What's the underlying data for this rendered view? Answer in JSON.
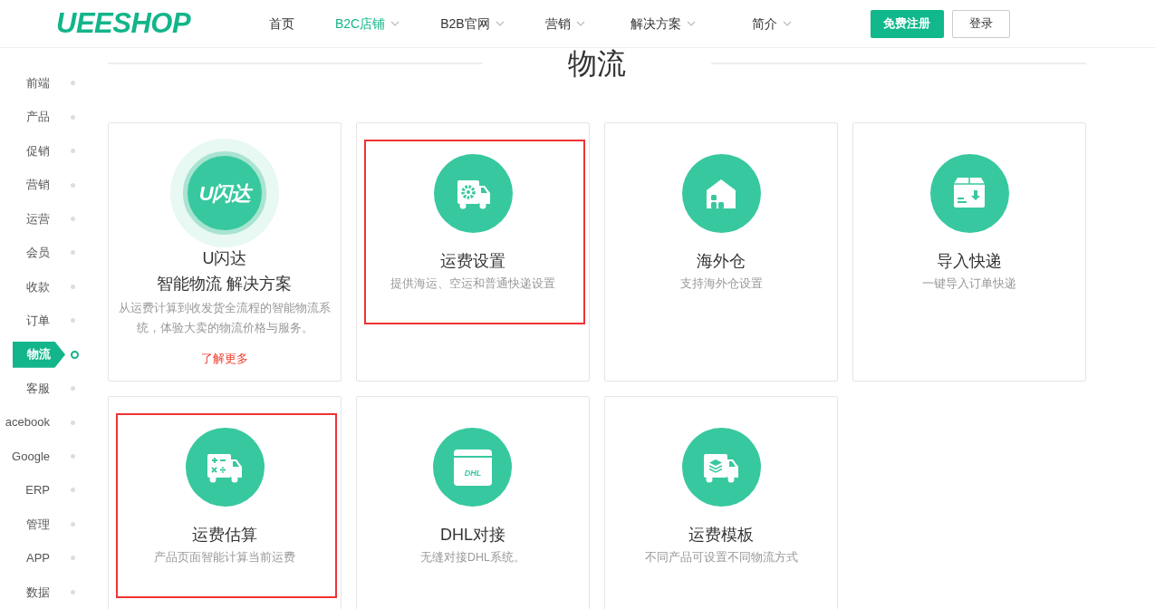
{
  "header": {
    "logo": "UEESHOP",
    "nav": [
      {
        "label": "首页",
        "selected": false,
        "dropdown": false
      },
      {
        "label": "B2C店铺",
        "selected": true,
        "dropdown": true
      },
      {
        "label": "B2B官网",
        "selected": false,
        "dropdown": true
      },
      {
        "label": "营销",
        "selected": false,
        "dropdown": true
      },
      {
        "label": "解决方案",
        "selected": false,
        "dropdown": true
      },
      {
        "label": "简介",
        "selected": false,
        "dropdown": true
      }
    ],
    "register_button": "免费注册",
    "login_button": "登录"
  },
  "sidebar": {
    "items": [
      {
        "label": "前端",
        "selected": false
      },
      {
        "label": "产品",
        "selected": false
      },
      {
        "label": "促销",
        "selected": false
      },
      {
        "label": "营销",
        "selected": false
      },
      {
        "label": "运营",
        "selected": false
      },
      {
        "label": "会员",
        "selected": false
      },
      {
        "label": "收款",
        "selected": false
      },
      {
        "label": "订单",
        "selected": false
      },
      {
        "label": "物流",
        "selected": true
      },
      {
        "label": "客服",
        "selected": false
      },
      {
        "label": "acebook",
        "selected": false
      },
      {
        "label": "Google",
        "selected": false
      },
      {
        "label": "ERP",
        "selected": false
      },
      {
        "label": "管理",
        "selected": false
      },
      {
        "label": "APP",
        "selected": false
      },
      {
        "label": "数据",
        "selected": false
      }
    ]
  },
  "section_title": "物流",
  "cards": [
    {
      "kind": "featured",
      "logo_text": "U闪达",
      "title": "U闪达",
      "subtitle": "智能物流 解决方案",
      "description": "从运费计算到收发货全流程的智能物流系统，体验大卖的物流价格与服务。",
      "link": "了解更多",
      "highlighted": false
    },
    {
      "kind": "feature",
      "title": "运费设置",
      "description": "提供海运、空运和普通快递设置",
      "highlighted": true
    },
    {
      "kind": "feature",
      "title": "海外仓",
      "description": "支持海外仓设置",
      "highlighted": false
    },
    {
      "kind": "feature",
      "title": "导入快递",
      "description": "一键导入订单快递",
      "highlighted": false
    },
    {
      "kind": "feature",
      "title": "运费估算",
      "description": "产品页面智能计算当前运费",
      "highlighted": true
    },
    {
      "kind": "feature",
      "icon_label": "DHL",
      "title": "DHL对接",
      "description": "无缝对接DHL系统。",
      "highlighted": false
    },
    {
      "kind": "feature",
      "title": "运费模板",
      "description": "不同产品可设置不同物流方式",
      "highlighted": false
    }
  ]
}
